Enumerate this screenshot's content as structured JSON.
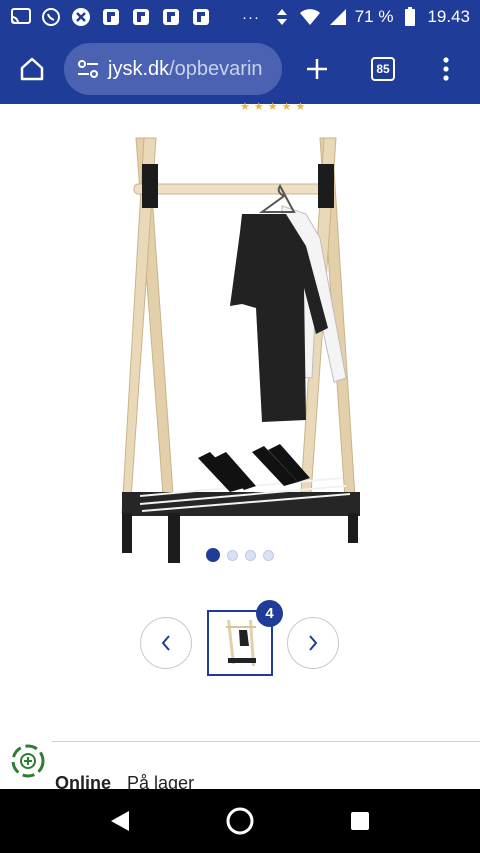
{
  "status_bar": {
    "battery": "71 %",
    "time": "19.43",
    "more": "···"
  },
  "browser": {
    "domain": "jysk.dk",
    "path": "/opbevarin",
    "tab_count": "85"
  },
  "product": {
    "image_name": "Garment rack with shoe shelf",
    "carousel_total": 4,
    "carousel_active": 1,
    "thumbnail_badge": "4"
  },
  "stock": {
    "online_label": "Online",
    "status": "På lager"
  },
  "colors": {
    "brand": "#1f3c99",
    "omnibox": "#4a62b1",
    "stars": "#e8b84a"
  }
}
